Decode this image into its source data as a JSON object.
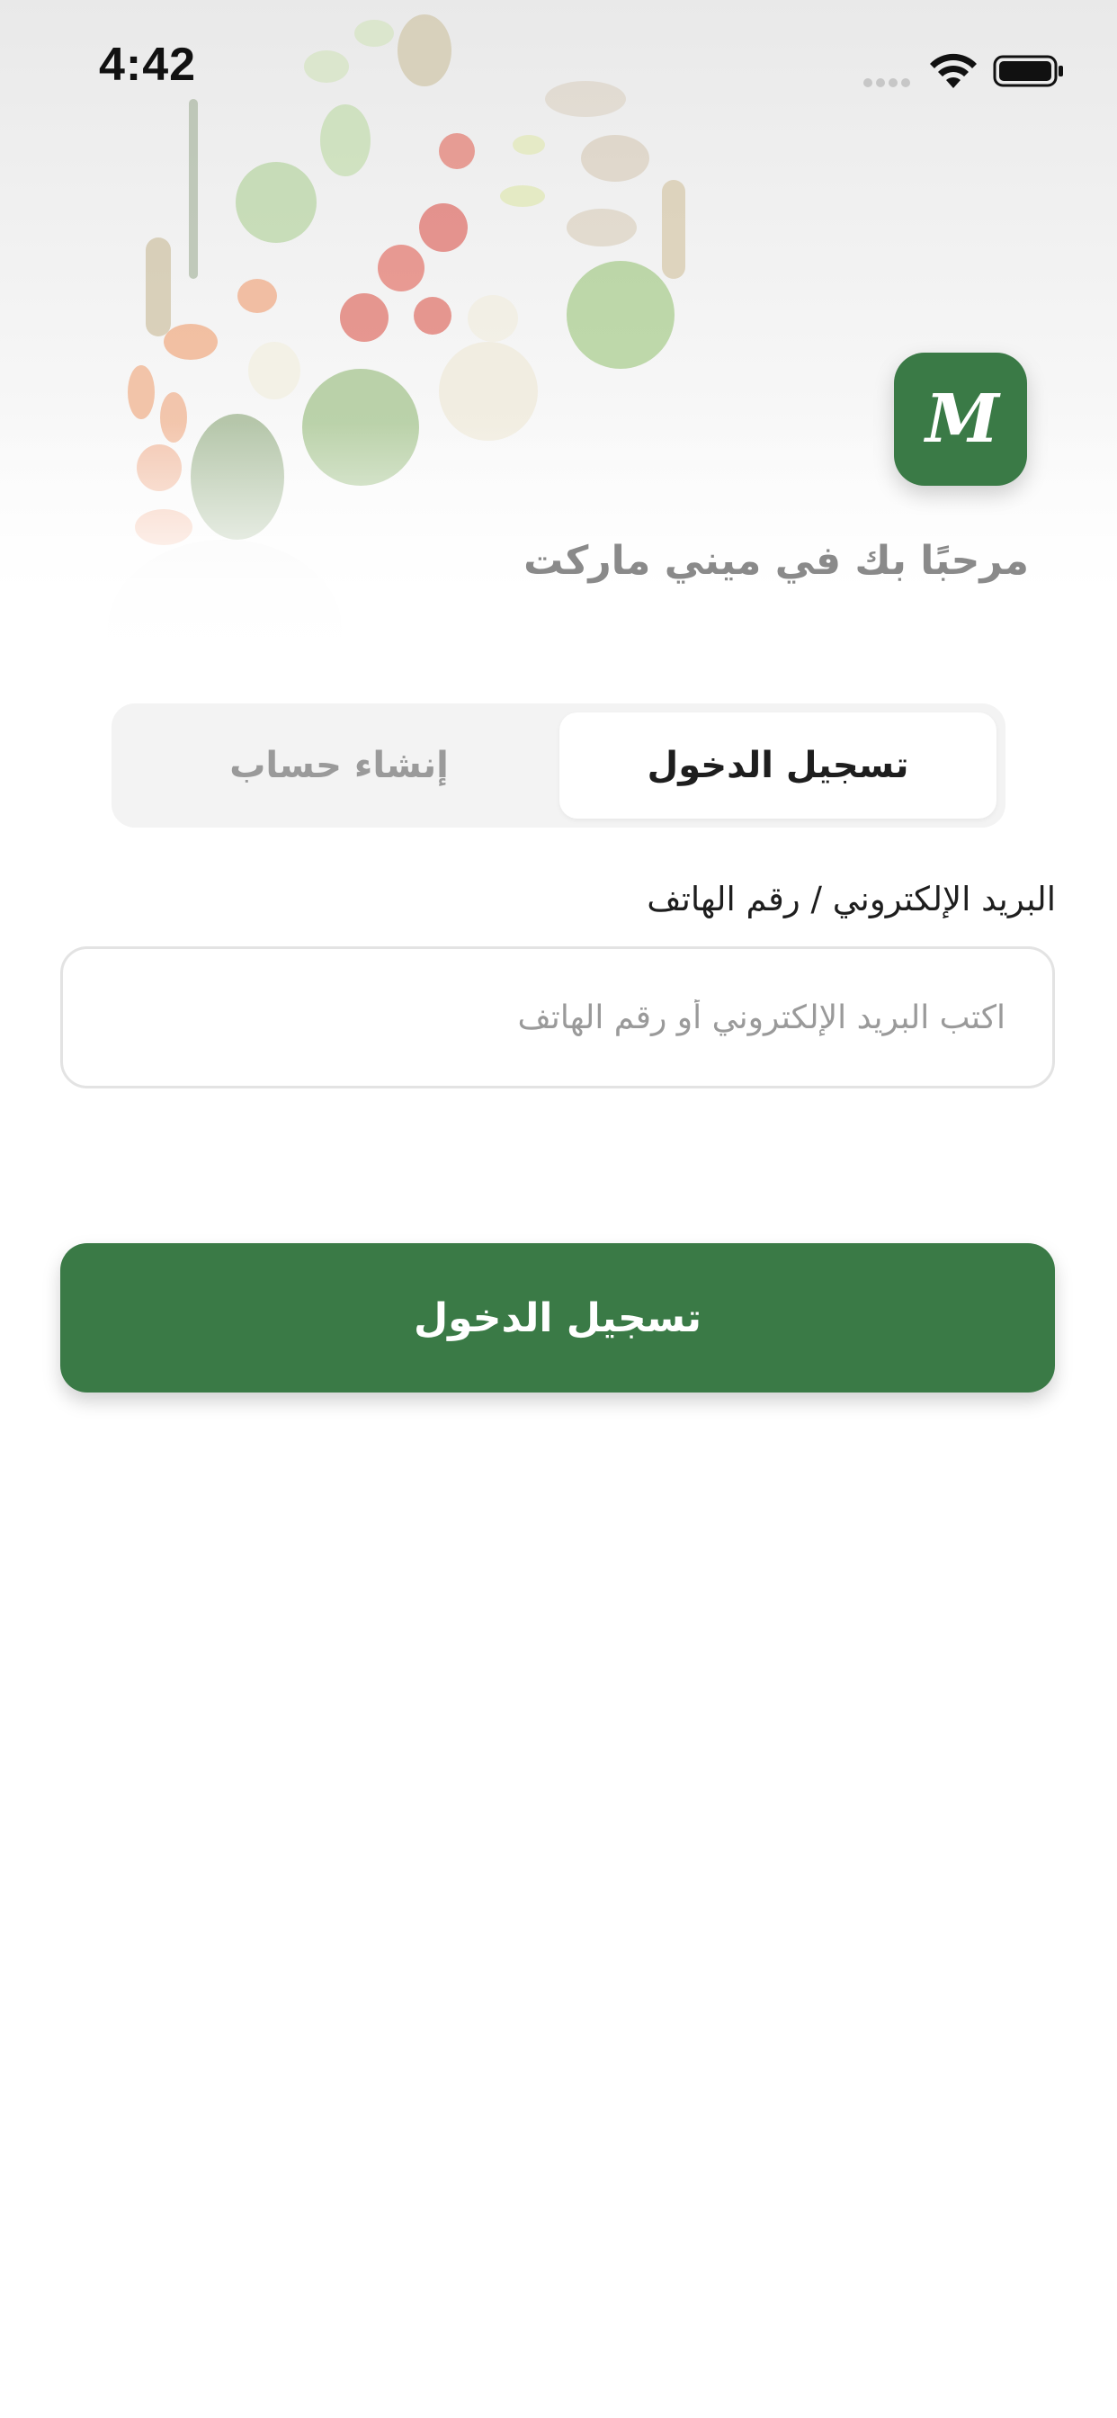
{
  "status_bar": {
    "time": "4:42",
    "signal_icon": "signal-dots-icon",
    "wifi_icon": "wifi-icon",
    "battery_icon": "battery-full-icon"
  },
  "header": {
    "logo_text": "M",
    "welcome_text": "مرحبًا بك في ميني ماركت"
  },
  "tabs": [
    {
      "label": "تسجيل الدخول",
      "active": true
    },
    {
      "label": "إنشاء حساب",
      "active": false
    }
  ],
  "form": {
    "field_label": "البريد الإلكتروني / رقم الهاتف",
    "field_placeholder": "اكتب البريد الإلكتروني أو رقم الهاتف",
    "field_value": ""
  },
  "actions": {
    "login_button_label": "تسجيل الدخول"
  },
  "colors": {
    "brand_green": "#3a7a46",
    "muted_text": "#8a8a8a"
  }
}
